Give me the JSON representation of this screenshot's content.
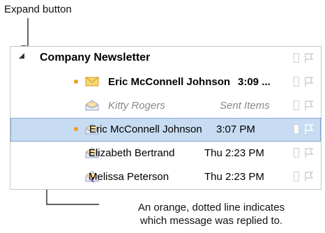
{
  "annotations": {
    "expand_caption": "Expand button",
    "dotted_caption_line1": "An orange, dotted line indicates",
    "dotted_caption_line2": "which message was replied to."
  },
  "conversation": {
    "title": "Company Newsletter",
    "messages": [
      {
        "sender": "Eric McConnell Johnson",
        "meta": "3:09 ...",
        "style": "unread",
        "icon": "envelope-unread-icon"
      },
      {
        "sender": "Kitty Rogers",
        "meta": "Sent Items",
        "style": "sent",
        "icon": "envelope-open-icon"
      },
      {
        "sender": "Eric McConnell Johnson",
        "meta": "3:07 PM",
        "style": "selected",
        "icon": "envelope-open-icon"
      },
      {
        "sender": "Elizabeth Bertrand",
        "meta": "Thu 2:23 PM",
        "style": "read",
        "icon": "envelope-open-icon"
      },
      {
        "sender": "Melissa Peterson",
        "meta": "Thu 2:23 PM",
        "style": "replied",
        "icon": "envelope-reply-icon"
      }
    ]
  },
  "colors": {
    "accent_orange": "#f0a01e",
    "selection_blue": "#c7dcf2",
    "border_grey": "#c6c6c6",
    "muted_text": "#8a8a8a"
  }
}
